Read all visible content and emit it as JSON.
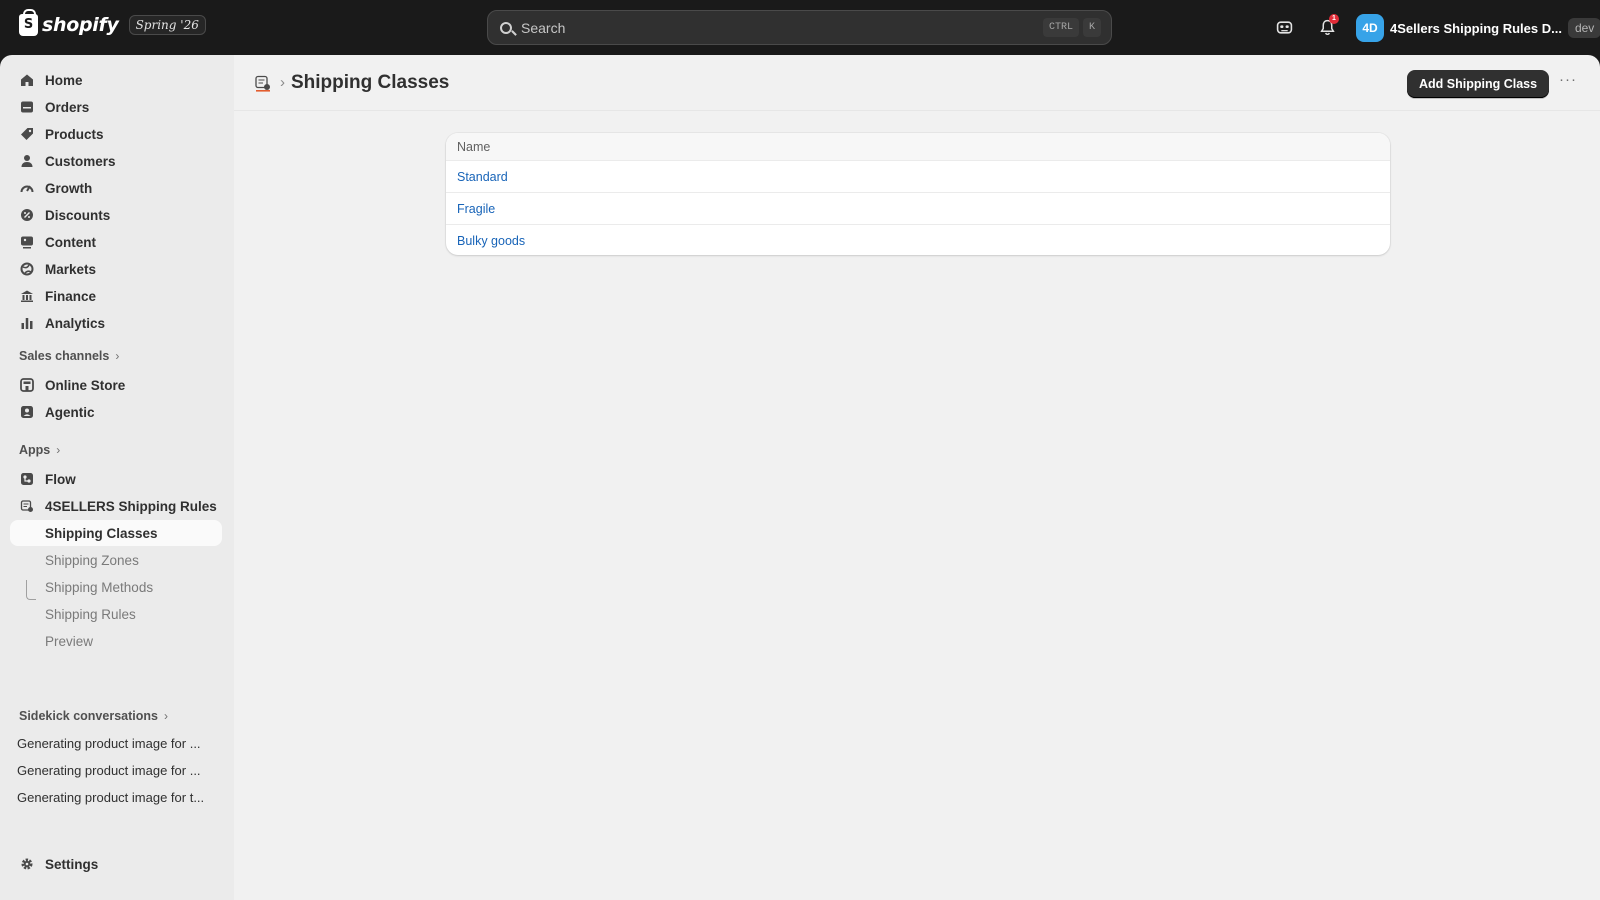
{
  "topbar": {
    "brand": "shopify",
    "brand_mark": "S",
    "edition": "Spring '26",
    "search_placeholder": "Search",
    "shortcut_keys": [
      "CTRL",
      "K"
    ],
    "notification_count": "1",
    "store_avatar": "4D",
    "store_name": "4Sellers Shipping Rules D...",
    "store_badge": "dev"
  },
  "sidebar": {
    "main_items": [
      {
        "label": "Home",
        "icon": "home-icon"
      },
      {
        "label": "Orders",
        "icon": "orders-icon"
      },
      {
        "label": "Products",
        "icon": "tag-icon"
      },
      {
        "label": "Customers",
        "icon": "person-icon"
      },
      {
        "label": "Growth",
        "icon": "gauge-icon"
      },
      {
        "label": "Discounts",
        "icon": "discount-icon"
      },
      {
        "label": "Content",
        "icon": "content-icon"
      },
      {
        "label": "Markets",
        "icon": "globe-icon"
      },
      {
        "label": "Finance",
        "icon": "bank-icon"
      },
      {
        "label": "Analytics",
        "icon": "bar-chart-icon"
      }
    ],
    "sales_channels_label": "Sales channels",
    "sales_channels": [
      {
        "label": "Online Store",
        "icon": "store-icon"
      },
      {
        "label": "Agentic",
        "icon": "agentic-icon"
      }
    ],
    "apps_label": "Apps",
    "apps": [
      {
        "label": "Flow",
        "icon": "flow-icon"
      },
      {
        "label": "4SELLERS Shipping Rules",
        "icon": "app-icon"
      }
    ],
    "app_subitems": [
      {
        "label": "Shipping Classes",
        "active": true
      },
      {
        "label": "Shipping Zones",
        "active": false
      },
      {
        "label": "Shipping Methods",
        "active": false
      },
      {
        "label": "Shipping Rules",
        "active": false
      },
      {
        "label": "Preview",
        "active": false
      }
    ],
    "sidekick_label": "Sidekick conversations",
    "conversations": [
      "Generating product image for ...",
      "Generating product image for ...",
      "Generating product image for t..."
    ],
    "settings_label": "Settings"
  },
  "main": {
    "page_title": "Shipping Classes",
    "add_button": "Add Shipping Class",
    "more_button": "···",
    "table": {
      "header": "Name",
      "rows": [
        "Standard",
        "Fragile",
        "Bulky goods"
      ]
    }
  }
}
